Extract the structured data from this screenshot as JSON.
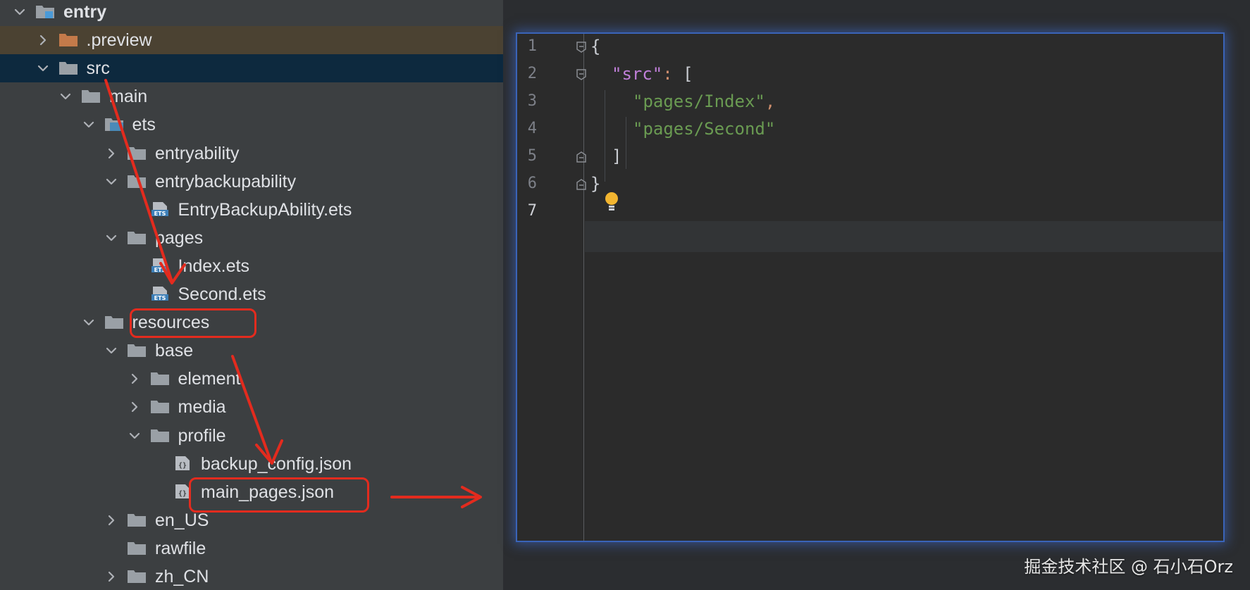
{
  "tree": {
    "rows": [
      {
        "label": "entry",
        "depth": 0,
        "chevron": "down",
        "icon": "module-folder-icon",
        "bold": true
      },
      {
        "label": ".preview",
        "depth": 1,
        "chevron": "right",
        "icon": "orange-folder-icon",
        "highlight": "preview"
      },
      {
        "label": "src",
        "depth": 1,
        "chevron": "down",
        "icon": "folder-icon",
        "highlight": "src"
      },
      {
        "label": "main",
        "depth": 2,
        "chevron": "down",
        "icon": "folder-icon"
      },
      {
        "label": "ets",
        "depth": 3,
        "chevron": "down",
        "icon": "source-folder-icon"
      },
      {
        "label": "entryability",
        "depth": 4,
        "chevron": "right",
        "icon": "folder-icon"
      },
      {
        "label": "entrybackupability",
        "depth": 4,
        "chevron": "down",
        "icon": "folder-icon"
      },
      {
        "label": "EntryBackupAbility.ets",
        "depth": 5,
        "chevron": "none",
        "icon": "ets-file-icon"
      },
      {
        "label": "pages",
        "depth": 4,
        "chevron": "down",
        "icon": "folder-icon"
      },
      {
        "label": "Index.ets",
        "depth": 5,
        "chevron": "none",
        "icon": "ets-file-icon"
      },
      {
        "label": "Second.ets",
        "depth": 5,
        "chevron": "none",
        "icon": "ets-file-icon"
      },
      {
        "label": "resources",
        "depth": 3,
        "chevron": "down",
        "icon": "folder-icon"
      },
      {
        "label": "base",
        "depth": 4,
        "chevron": "down",
        "icon": "folder-icon"
      },
      {
        "label": "element",
        "depth": 5,
        "chevron": "right",
        "icon": "folder-icon"
      },
      {
        "label": "media",
        "depth": 5,
        "chevron": "right",
        "icon": "folder-icon"
      },
      {
        "label": "profile",
        "depth": 5,
        "chevron": "down",
        "icon": "folder-icon"
      },
      {
        "label": "backup_config.json",
        "depth": 6,
        "chevron": "none",
        "icon": "json-file-icon"
      },
      {
        "label": "main_pages.json",
        "depth": 6,
        "chevron": "none",
        "icon": "json-file-icon"
      },
      {
        "label": "en_US",
        "depth": 4,
        "chevron": "right",
        "icon": "folder-icon"
      },
      {
        "label": "rawfile",
        "depth": 4,
        "chevron": "none",
        "icon": "folder-icon"
      },
      {
        "label": "zh_CN",
        "depth": 4,
        "chevron": "right",
        "icon": "folder-icon"
      }
    ]
  },
  "editor": {
    "line_numbers": [
      "1",
      "2",
      "3",
      "4",
      "5",
      "6",
      "7"
    ],
    "active_line": "7",
    "lines": [
      {
        "punc_open": "{"
      },
      {
        "key": "\"src\"",
        "colon": ":",
        "bracket": " ["
      },
      {
        "string": "\"pages/Index\"",
        "comma": ","
      },
      {
        "string": "\"pages/Second\""
      },
      {
        "bracket_close": "]"
      },
      {
        "punc_close": "}"
      },
      {}
    ]
  },
  "colors": {
    "annotation": "#e32b1e",
    "tree_bg": "#3c3f41",
    "editor_bg": "#2b2b2b",
    "editor_border": "#3a64b8"
  },
  "watermark": "掘金技术社区 @ 石小石Orz"
}
